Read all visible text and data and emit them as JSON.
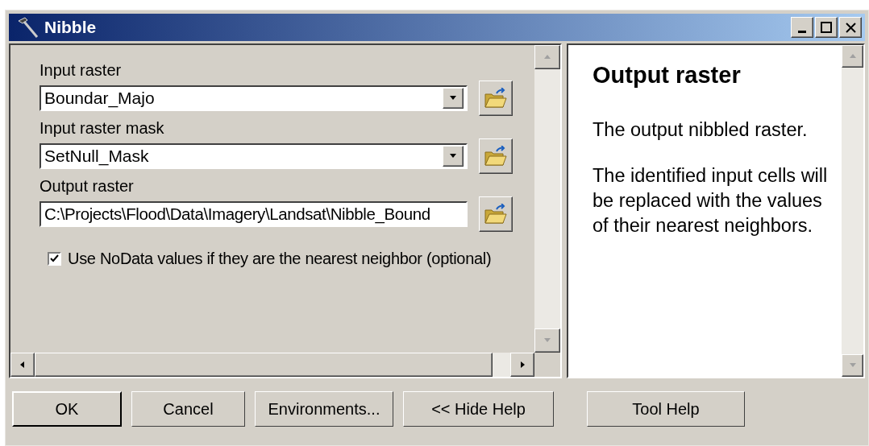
{
  "window": {
    "title": "Nibble"
  },
  "parameters": [
    {
      "kind": "combo",
      "label": "Input raster",
      "value": "Boundar_Majo"
    },
    {
      "kind": "combo",
      "label": "Input raster mask",
      "value": "SetNull_Mask"
    },
    {
      "kind": "text",
      "label": "Output raster",
      "value": "C:\\Projects\\Flood\\Data\\Imagery\\Landsat\\Nibble_Bound"
    },
    {
      "kind": "checkbox",
      "label": "Use NoData values if they are the nearest neighbor (optional)",
      "checked": true
    }
  ],
  "help": {
    "title": "Output raster",
    "paragraphs": [
      "The output nibbled raster.",
      "The identified input cells will be replaced with the values of their nearest neighbors."
    ]
  },
  "buttons": [
    {
      "label": "OK",
      "default": true
    },
    {
      "label": "Cancel",
      "default": false
    },
    {
      "label": "Environments...",
      "default": false
    },
    {
      "label": "<< Hide Help",
      "default": false
    },
    {
      "label": "Tool Help",
      "default": false
    }
  ]
}
